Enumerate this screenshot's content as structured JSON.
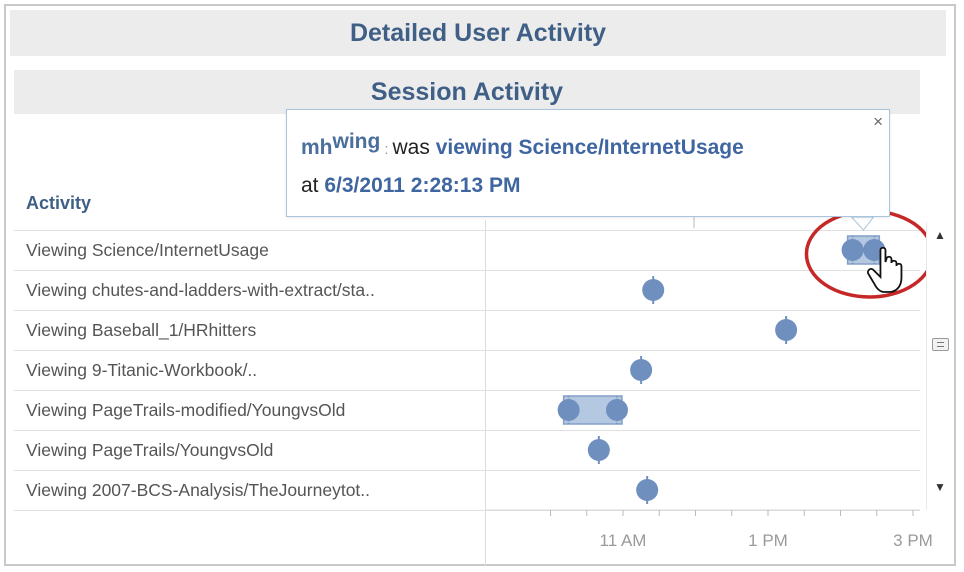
{
  "header": {
    "title": "Detailed User Activity"
  },
  "section": {
    "title": "Session Activity"
  },
  "table": {
    "activity_header": "Activity",
    "rows": [
      "Viewing Science/InternetUsage",
      "Viewing chutes-and-ladders-with-extract/sta..",
      "Viewing Baseball_1/HRhitters",
      "Viewing 9-Titanic-Workbook/..",
      "Viewing PageTrails-modified/YoungvsOld",
      "Viewing PageTrails/YoungvsOld",
      "Viewing 2007-BCS-Analysis/TheJourneytot.."
    ]
  },
  "tooltip": {
    "user_prefix": "mh",
    "user_suffix": "wing",
    "separator": ":",
    "was_text": "was",
    "action": "viewing Science/InternetUsage",
    "at_text": "at",
    "timestamp": "6/3/2011 2:28:13 PM",
    "close_glyph": "×"
  },
  "chart_data": {
    "type": "scatter",
    "x_ticks": [
      "11 AM",
      "1 PM",
      "3 PM"
    ],
    "colors": {
      "mark": "#6f8fbf",
      "highlight": "#c62828",
      "band": "#ececec",
      "heading": "#3f5f86"
    },
    "points": [
      {
        "row": "Viewing Science/InternetUsage",
        "times": [
          "2:10 PM",
          "2:28 PM"
        ],
        "selected": true
      },
      {
        "row": "Viewing chutes-and-ladders-with-extract/sta..",
        "times": [
          "11:25 AM"
        ]
      },
      {
        "row": "Viewing Baseball_1/HRhitters",
        "times": [
          "1:15 PM"
        ]
      },
      {
        "row": "Viewing 9-Titanic-Workbook/..",
        "times": [
          "11:15 AM"
        ]
      },
      {
        "row": "Viewing PageTrails-modified/YoungvsOld",
        "times": [
          "10:15 AM",
          "10:55 AM"
        ]
      },
      {
        "row": "Viewing PageTrails/YoungvsOld",
        "times": [
          "10:40 AM"
        ]
      },
      {
        "row": "Viewing 2007-BCS-Analysis/TheJourneytot..",
        "times": [
          "11:20 AM"
        ]
      }
    ]
  },
  "scrollbar": {
    "up_glyph": "▲",
    "down_glyph": "▼"
  },
  "cursor": {
    "icon": "hand-pointer-icon"
  }
}
